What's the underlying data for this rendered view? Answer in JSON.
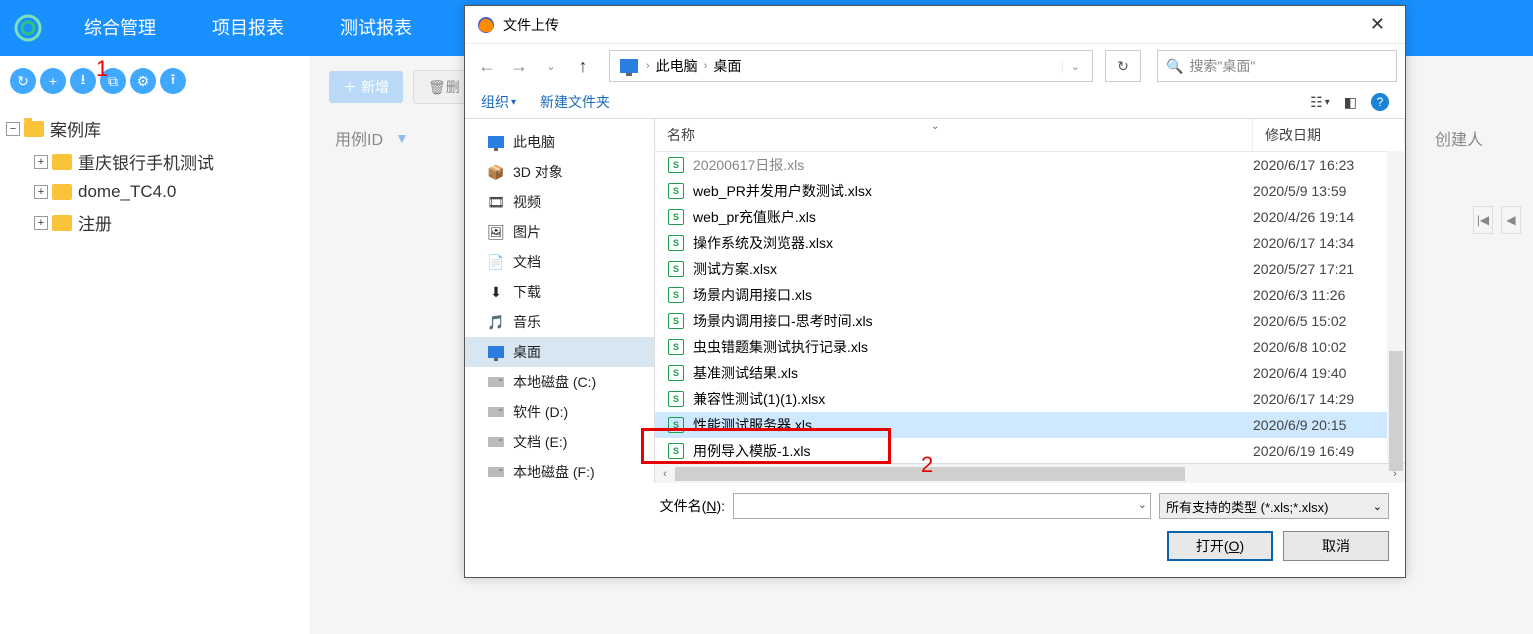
{
  "topnav": {
    "items": [
      "综合管理",
      "项目报表",
      "测试报表"
    ]
  },
  "annotations": {
    "a1": "1",
    "a2": "2"
  },
  "tree": {
    "root": "案例库",
    "children": [
      "重庆银行手机测试",
      "dome_TC4.0",
      "注册"
    ]
  },
  "main": {
    "new_btn": "新增",
    "del_btn": "删",
    "col_id": "用例ID",
    "col_creator": "创建人"
  },
  "dialog": {
    "title": "文件上传",
    "path": {
      "p1": "此电脑",
      "p2": "桌面"
    },
    "search_placeholder": "搜索\"桌面\"",
    "organize": "组织",
    "new_folder": "新建文件夹",
    "columns": {
      "name": "名称",
      "date": "修改日期"
    },
    "sidebar": [
      {
        "label": "此电脑",
        "icon": "monitor"
      },
      {
        "label": "3D 对象",
        "icon": "cube"
      },
      {
        "label": "视频",
        "icon": "video"
      },
      {
        "label": "图片",
        "icon": "image"
      },
      {
        "label": "文档",
        "icon": "doc"
      },
      {
        "label": "下载",
        "icon": "download"
      },
      {
        "label": "音乐",
        "icon": "music"
      },
      {
        "label": "桌面",
        "icon": "desktop",
        "selected": true
      },
      {
        "label": "本地磁盘 (C:)",
        "icon": "disk"
      },
      {
        "label": "软件 (D:)",
        "icon": "disk"
      },
      {
        "label": "文档 (E:)",
        "icon": "disk"
      },
      {
        "label": "本地磁盘 (F:)",
        "icon": "disk"
      }
    ],
    "files": [
      {
        "name": "20200617日报.xls",
        "date": "2020/6/17 16:23",
        "cut": true
      },
      {
        "name": "web_PR并发用户数测试.xlsx",
        "date": "2020/5/9 13:59"
      },
      {
        "name": "web_pr充值账户.xls",
        "date": "2020/4/26 19:14"
      },
      {
        "name": "操作系统及浏览器.xlsx",
        "date": "2020/6/17 14:34"
      },
      {
        "name": "测试方案.xlsx",
        "date": "2020/5/27 17:21"
      },
      {
        "name": "场景内调用接口.xls",
        "date": "2020/6/3 11:26"
      },
      {
        "name": "场景内调用接口-思考时间.xls",
        "date": "2020/6/5 15:02"
      },
      {
        "name": "虫虫错题集测试执行记录.xls",
        "date": "2020/6/8 10:02"
      },
      {
        "name": "基准测试结果.xls",
        "date": "2020/6/4 19:40"
      },
      {
        "name": "兼容性测试(1)(1).xlsx",
        "date": "2020/6/17 14:29"
      },
      {
        "name": "性能测试服务器.xls",
        "date": "2020/6/9 20:15",
        "selected": true
      },
      {
        "name": "用例导入模版-1.xls",
        "date": "2020/6/19 16:49"
      }
    ],
    "filename_label_pre": "文件名(",
    "filename_label_u": "N",
    "filename_label_post": "):",
    "type_filter": "所有支持的类型 (*.xls;*.xlsx)",
    "open_btn_pre": "打开(",
    "open_btn_u": "O",
    "open_btn_post": ")",
    "cancel_btn": "取消"
  }
}
